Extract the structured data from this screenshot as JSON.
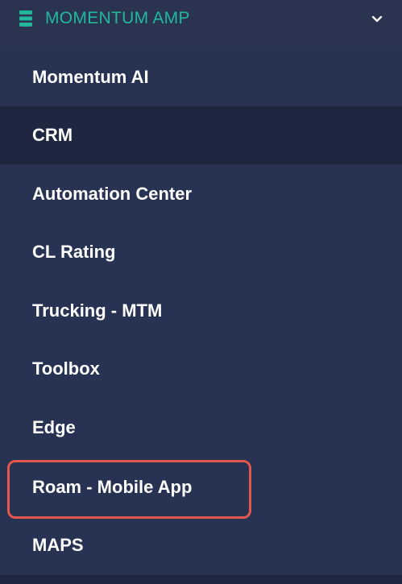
{
  "header": {
    "label": "MOMENTUM AMP",
    "icon": "database-stack-icon",
    "toggle_icon": "chevron-down-icon",
    "accent_color": "#22b99a"
  },
  "menu": {
    "active_item": "CRM",
    "highlighted_item": "Roam - Mobile App",
    "items": [
      {
        "label": "Momentum AI"
      },
      {
        "label": "CRM"
      },
      {
        "label": "Automation Center"
      },
      {
        "label": "CL Rating"
      },
      {
        "label": "Trucking - MTM"
      },
      {
        "label": "Toolbox"
      },
      {
        "label": "Edge"
      },
      {
        "label": "Roam - Mobile App"
      },
      {
        "label": "MAPS"
      }
    ]
  },
  "colors": {
    "background": "#2a3350",
    "active_background": "#1f2740",
    "text": "#ffffff",
    "highlight_border": "#e4574c"
  }
}
